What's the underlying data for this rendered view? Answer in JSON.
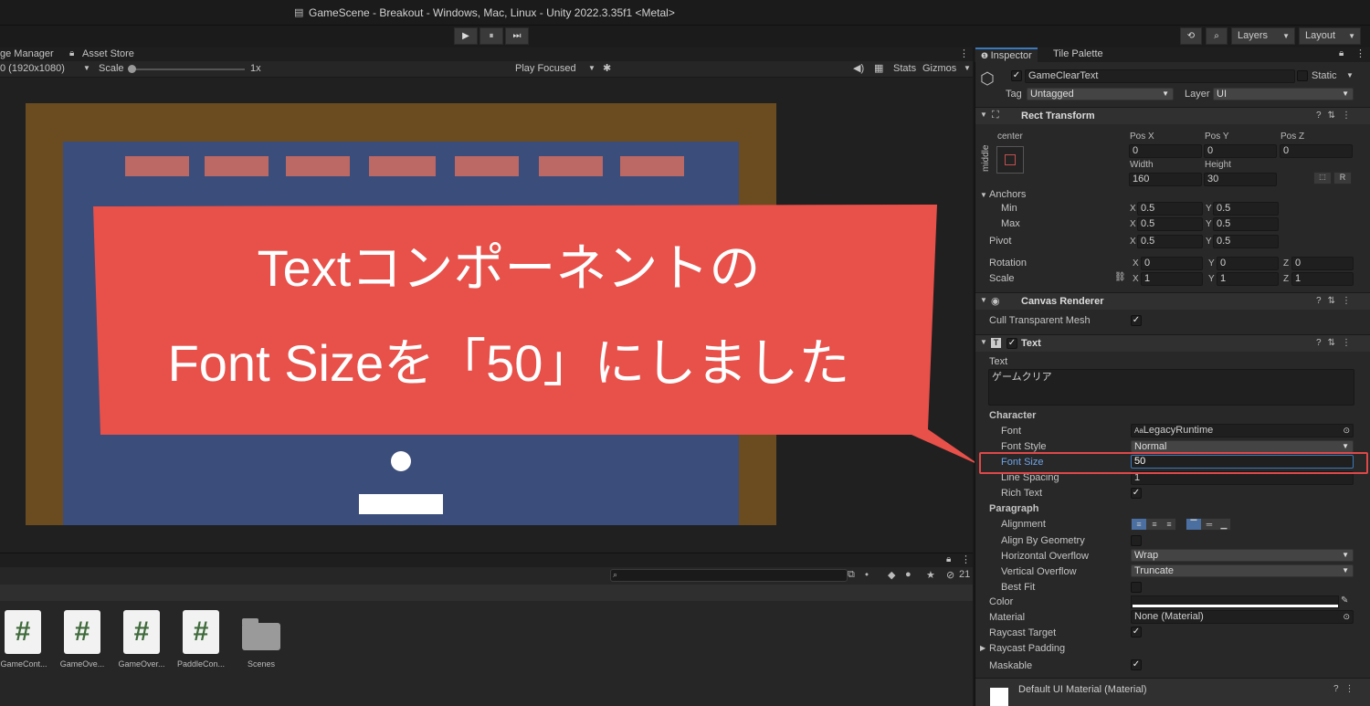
{
  "window": {
    "title": "GameScene - Breakout - Windows, Mac, Linux - Unity 2022.3.35f1 <Metal>"
  },
  "toolbar": {
    "play_glyph": "▶",
    "pause_glyph": "⏸",
    "step_glyph": "⏭",
    "history_glyph": "⟲",
    "search_glyph": "⌕",
    "layers": "Layers",
    "layout": "Layout"
  },
  "game_tabs": {
    "package_manager": "ge Manager",
    "asset_store": "Asset Store"
  },
  "game_toolbar": {
    "resolution": "0 (1920x1080)",
    "scale_label": "Scale",
    "scale_value": "1x",
    "play_mode": "Play Focused",
    "stats": "Stats",
    "gizmos": "Gizmos"
  },
  "callout": {
    "line1": "Textコンポーネントの",
    "line2": "Font Sizeを「50」にしました",
    "color": "#e8504a"
  },
  "project": {
    "hidden_count": "21",
    "assets": [
      {
        "label": "GameCont...",
        "icon": "csharp-script-icon",
        "glyph": "#"
      },
      {
        "label": "GameOve...",
        "icon": "csharp-script-icon",
        "glyph": "#"
      },
      {
        "label": "GameOver...",
        "icon": "csharp-script-icon",
        "glyph": "#"
      },
      {
        "label": "PaddleCon...",
        "icon": "csharp-script-icon",
        "glyph": "#"
      },
      {
        "label": "Scenes",
        "icon": "folder-icon",
        "glyph": ""
      }
    ]
  },
  "inspector": {
    "tab_inspector": "Inspector",
    "tab_tile_palette": "Tile Palette",
    "object_name": "GameClearText",
    "static_label": "Static",
    "tag_label": "Tag",
    "tag_value": "Untagged",
    "layer_label": "Layer",
    "layer_value": "UI",
    "rect_transform": {
      "title": "Rect Transform",
      "anchor_h": "center",
      "anchor_v": "middle",
      "pos_x_label": "Pos X",
      "pos_y_label": "Pos Y",
      "pos_z_label": "Pos Z",
      "pos_x": "0",
      "pos_y": "0",
      "pos_z": "0",
      "width_label": "Width",
      "height_label": "Height",
      "width": "160",
      "height": "30",
      "r_button": "R",
      "anchors_label": "Anchors",
      "min_label": "Min",
      "max_label": "Max",
      "pivot_label": "Pivot",
      "min_x": "0.5",
      "min_y": "0.5",
      "max_x": "0.5",
      "max_y": "0.5",
      "pivot_x": "0.5",
      "pivot_y": "0.5",
      "rotation_label": "Rotation",
      "rot_x": "0",
      "rot_y": "0",
      "rot_z": "0",
      "scale_label": "Scale",
      "scale_x": "1",
      "scale_y": "1",
      "scale_z": "1",
      "x": "X",
      "y": "Y",
      "z": "Z"
    },
    "canvas_renderer": {
      "title": "Canvas Renderer",
      "cull_label": "Cull Transparent Mesh",
      "cull_checked": "✓"
    },
    "text_component": {
      "title": "Text",
      "text_label": "Text",
      "text_value": "ゲームクリア",
      "character_label": "Character",
      "font_label": "Font",
      "font_value": "LegacyRuntime",
      "font_prefix": "Aa",
      "font_style_label": "Font Style",
      "font_style_value": "Normal",
      "font_size_label": "Font Size",
      "font_size_value": "50",
      "line_spacing_label": "Line Spacing",
      "line_spacing_value": "1",
      "rich_text_label": "Rich Text",
      "rich_text_checked": "✓",
      "paragraph_label": "Paragraph",
      "alignment_label": "Alignment",
      "align_by_geometry_label": "Align By Geometry",
      "horizontal_overflow_label": "Horizontal Overflow",
      "horizontal_overflow_value": "Wrap",
      "vertical_overflow_label": "Vertical Overflow",
      "vertical_overflow_value": "Truncate",
      "best_fit_label": "Best Fit",
      "color_label": "Color",
      "color_value": "#ffffff",
      "material_label": "Material",
      "material_value": "None (Material)",
      "raycast_target_label": "Raycast Target",
      "raycast_target_checked": "✓",
      "raycast_padding_label": "Raycast Padding",
      "maskable_label": "Maskable",
      "maskable_checked": "✓"
    },
    "material_preview": {
      "title": "Default UI Material (Material)"
    }
  },
  "colors": {
    "accent": "#3a79bb",
    "highlight": "#e04848",
    "wall": "#6b4b20",
    "field": "#3b4d7a",
    "brick": "#bc6864"
  }
}
